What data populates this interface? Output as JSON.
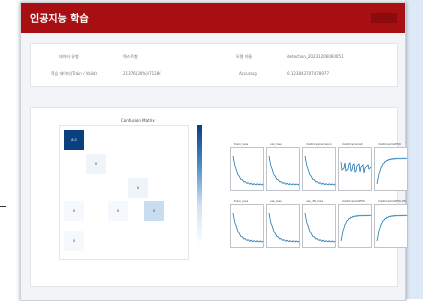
{
  "window": {
    "title": "인공지능 학습"
  },
  "info": {
    "row1": {
      "label_left": "데이터 유형",
      "value_left": "텍스트형",
      "label_right": "모델 이름",
      "value_right": "detection_20231206060051"
    },
    "row2": {
      "label_left": "학습 데이터(Train / Valid)",
      "value_left": "21376(30%)/7128(",
      "label_right": "Accuracy",
      "value_right": "0.123843707478977"
    }
  },
  "confusion_matrix": {
    "title": "Confusion Matrix",
    "diag_main_value": "8.0",
    "cell_values": [
      "0",
      "0",
      "0",
      "0",
      "0",
      "0"
    ]
  },
  "colors": {
    "header": "#a80f12",
    "accent": "#1f77b4",
    "cm_dark": "#0b3f7d"
  },
  "subplots": [
    {
      "title": "train_loss"
    },
    {
      "title": "val_loss"
    },
    {
      "title": "metrics/precision"
    },
    {
      "title": "metrics/recall"
    },
    {
      "title": "metrics/mAP50"
    },
    {
      "title": "train_loss"
    },
    {
      "title": "val_loss"
    },
    {
      "title": "val_dfl_loss"
    },
    {
      "title": "metrics/mAP50"
    },
    {
      "title": "metrics/mAP50-95"
    }
  ]
}
